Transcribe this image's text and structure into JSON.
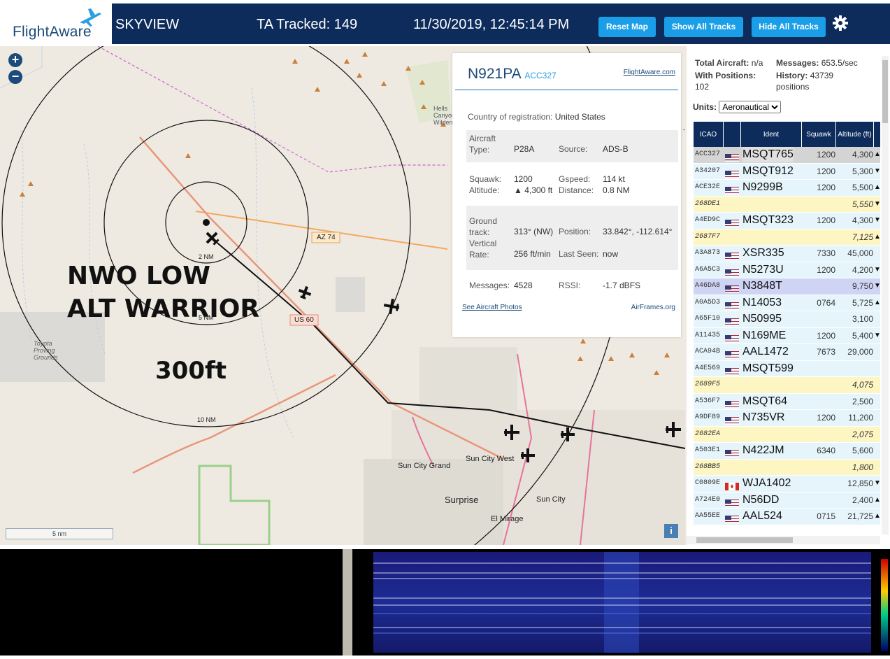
{
  "header": {
    "logo": "FlightAware",
    "app_name": "SKYVIEW",
    "tracked": "TA Tracked: 149",
    "datetime": "11/30/2019, 12:45:14 PM",
    "buttons": {
      "reset": "Reset Map",
      "show": "Show All Tracks",
      "hide": "Hide All Tracks"
    },
    "icons": {
      "settings": "gear-icon"
    }
  },
  "map": {
    "zoom_in": "+",
    "zoom_out": "−",
    "overlay": {
      "line1": "NWO LOW",
      "line2": "ALT WARRIOR",
      "line3": "300ft"
    },
    "range_labels": [
      "2 NM",
      "5 NM",
      "10 NM"
    ],
    "road_labels": [
      "AZ 74",
      "US 60"
    ],
    "place_labels": [
      "Sun City Grand",
      "Sun City West",
      "Surprise",
      "Sun City",
      "El Mirage",
      "Toyota Proving Grounds",
      "Hells Canyon Wilderness"
    ],
    "scale": "5 nm",
    "info_button": "i"
  },
  "popup": {
    "registration": "N921PA",
    "flight": "ACC327",
    "link": "FlightAware.com",
    "country_label": "Country of registration:",
    "country": "United States",
    "aircraft_type_label": "Aircraft Type:",
    "aircraft_type": "P28A",
    "source_label": "Source:",
    "source": "ADS-B",
    "squawk_label": "Squawk:",
    "squawk": "1200",
    "gspeed_label": "Gspeed:",
    "gspeed": "114 kt",
    "altitude_label": "Altitude:",
    "altitude": "▲ 4,300 ft",
    "distance_label": "Distance:",
    "distance": "0.8 NM",
    "track_label": "Ground track:",
    "track": "313° (NW)",
    "position_label": "Position:",
    "position": "33.842°, -112.614°",
    "vrate_label": "Vertical Rate:",
    "vrate": "256 ft/min",
    "lastseen_label": "Last Seen:",
    "lastseen": "now",
    "messages_label": "Messages:",
    "messages": "4528",
    "rssi_label": "RSSI:",
    "rssi": "-1.7 dBFS",
    "photos_link": "See Aircraft Photos",
    "airframes_link": "AirFrames.org"
  },
  "panel": {
    "total_label": "Total Aircraft:",
    "total": "n/a",
    "messages_label": "Messages:",
    "messages": "653.5/sec",
    "positions_label": "With Positions:",
    "positions": "102",
    "history_label": "History:",
    "history": "43739 positions",
    "units_label": "Units:",
    "units": "Aeronautical",
    "columns": [
      "ICAO",
      "",
      "Ident",
      "Squawk",
      "Altitude (ft)"
    ],
    "rows": [
      {
        "icao": "ACC327",
        "flag": "us",
        "ident": "MSQT765",
        "squawk": "1200",
        "alt": "4,300",
        "arrow": "▲",
        "style": "selected"
      },
      {
        "icao": "A34207",
        "flag": "us",
        "ident": "MSQT912",
        "squawk": "1200",
        "alt": "5,300",
        "arrow": "▼",
        "style": "normal"
      },
      {
        "icao": "ACE32E",
        "flag": "us",
        "ident": "N9299B",
        "squawk": "1200",
        "alt": "5,500",
        "arrow": "▲",
        "style": "normal"
      },
      {
        "icao": "268DE1",
        "flag": "",
        "ident": "",
        "squawk": "",
        "alt": "5,550",
        "arrow": "▼",
        "style": "mlat"
      },
      {
        "icao": "A4ED9C",
        "flag": "us",
        "ident": "MSQT323",
        "squawk": "1200",
        "alt": "4,300",
        "arrow": "▼",
        "style": "normal"
      },
      {
        "icao": "2687F7",
        "flag": "",
        "ident": "",
        "squawk": "",
        "alt": "7,125",
        "arrow": "▲",
        "style": "mlat"
      },
      {
        "icao": "A3A873",
        "flag": "us",
        "ident": "XSR335",
        "squawk": "7330",
        "alt": "45,000",
        "arrow": "",
        "style": "normal"
      },
      {
        "icao": "A6A5C3",
        "flag": "us",
        "ident": "N5273U",
        "squawk": "1200",
        "alt": "4,200",
        "arrow": "▼",
        "style": "normal"
      },
      {
        "icao": "A46DA8",
        "flag": "us",
        "ident": "N3848T",
        "squawk": "",
        "alt": "9,750",
        "arrow": "▼",
        "style": "blue"
      },
      {
        "icao": "A0A5D3",
        "flag": "us",
        "ident": "N14053",
        "squawk": "0764",
        "alt": "5,725",
        "arrow": "▲",
        "style": "normal"
      },
      {
        "icao": "A65F10",
        "flag": "us",
        "ident": "N50995",
        "squawk": "",
        "alt": "3,100",
        "arrow": "",
        "style": "normal"
      },
      {
        "icao": "A11435",
        "flag": "us",
        "ident": "N169ME",
        "squawk": "1200",
        "alt": "5,400",
        "arrow": "▼",
        "style": "normal"
      },
      {
        "icao": "ACA94B",
        "flag": "us",
        "ident": "AAL1472",
        "squawk": "7673",
        "alt": "29,000",
        "arrow": "",
        "style": "normal"
      },
      {
        "icao": "A4E569",
        "flag": "us",
        "ident": "MSQT599",
        "squawk": "",
        "alt": "",
        "arrow": "",
        "style": "normal"
      },
      {
        "icao": "2689F5",
        "flag": "",
        "ident": "",
        "squawk": "",
        "alt": "4,075",
        "arrow": "",
        "style": "mlat"
      },
      {
        "icao": "A536F7",
        "flag": "us",
        "ident": "MSQT64",
        "squawk": "",
        "alt": "2,500",
        "arrow": "",
        "style": "normal"
      },
      {
        "icao": "A9DF89",
        "flag": "us",
        "ident": "N735VR",
        "squawk": "1200",
        "alt": "11,200",
        "arrow": "",
        "style": "normal"
      },
      {
        "icao": "2682EA",
        "flag": "",
        "ident": "",
        "squawk": "",
        "alt": "2,075",
        "arrow": "",
        "style": "mlat"
      },
      {
        "icao": "A503E1",
        "flag": "us",
        "ident": "N422JM",
        "squawk": "6340",
        "alt": "5,600",
        "arrow": "",
        "style": "normal"
      },
      {
        "icao": "268BB5",
        "flag": "",
        "ident": "",
        "squawk": "",
        "alt": "1,800",
        "arrow": "",
        "style": "mlat"
      },
      {
        "icao": "C0809E",
        "flag": "ca",
        "ident": "WJA1402",
        "squawk": "",
        "alt": "12,850",
        "arrow": "▼",
        "style": "normal"
      },
      {
        "icao": "A724E0",
        "flag": "us",
        "ident": "N56DD",
        "squawk": "",
        "alt": "2,400",
        "arrow": "▲",
        "style": "normal"
      },
      {
        "icao": "AA55EE",
        "flag": "us",
        "ident": "AAL524",
        "squawk": "0715",
        "alt": "21,725",
        "arrow": "▲",
        "style": "normal"
      }
    ]
  },
  "colors": {
    "navy": "#0d2c5b",
    "button": "#1b9ee8",
    "mlat_row": "#fdf5c2",
    "row": "#e6f5fb",
    "selected": "#d4d4d4",
    "blue_row": "#d0d4f4"
  }
}
